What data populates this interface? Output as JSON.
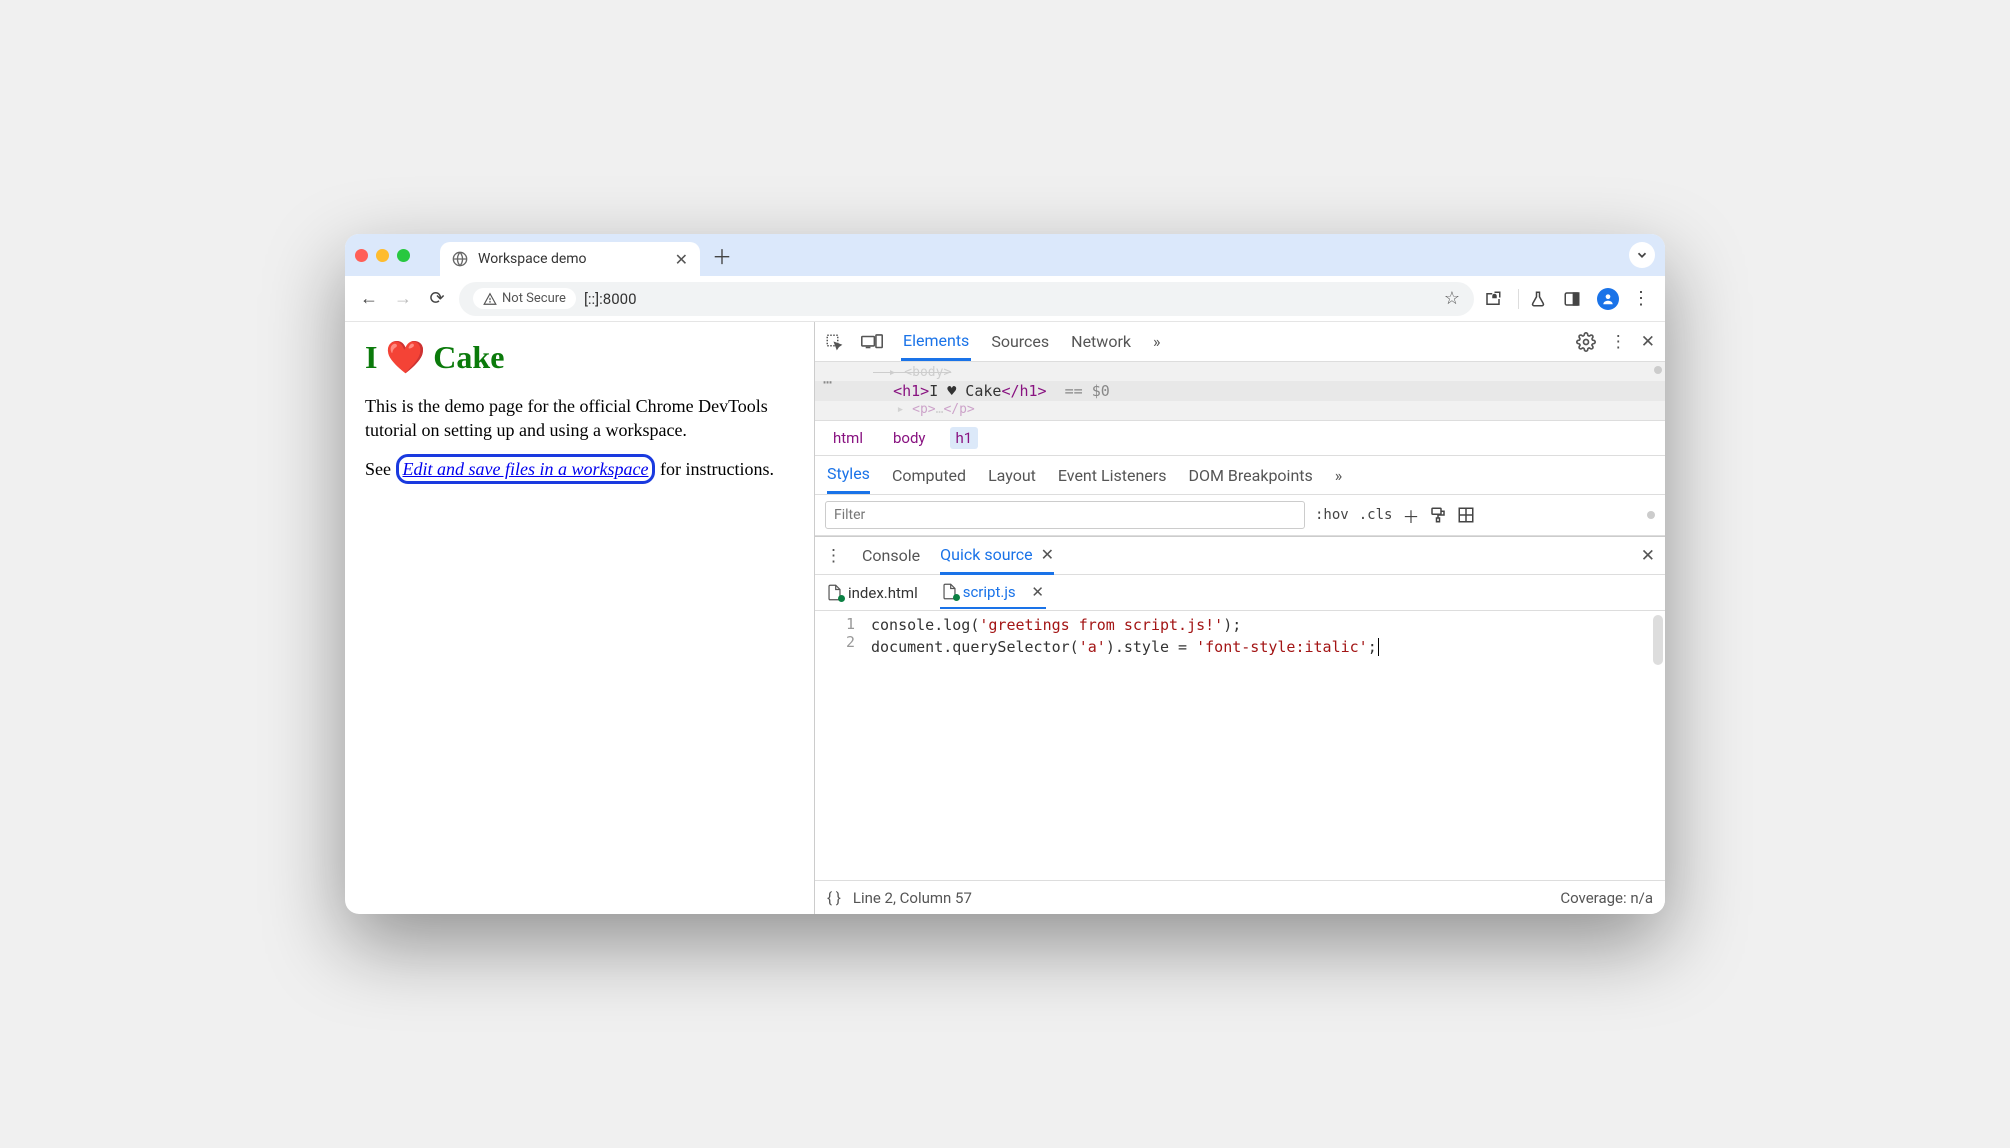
{
  "window": {
    "tab_title": "Workspace demo",
    "security_label": "Not Secure",
    "url": "[::]:8000"
  },
  "page": {
    "heading_prefix": "I ",
    "heading_emoji": "❤️",
    "heading_suffix": " Cake",
    "para1": "This is the demo page for the official Chrome DevTools tutorial on setting up and using a workspace.",
    "para2_prefix": "See ",
    "para2_link": "Edit and save files in a workspace",
    "para2_suffix": " for instructions."
  },
  "devtools": {
    "tabs": {
      "elements": "Elements",
      "sources": "Sources",
      "network": "Network"
    },
    "dom": {
      "line_before": "<body>",
      "h1_open": "<h1>",
      "h1_text": "I ♥ Cake",
      "h1_close": "</h1>",
      "eq": "== $0",
      "line_after": "<p>…</p>"
    },
    "crumbs": {
      "html": "html",
      "body": "body",
      "h1": "h1"
    },
    "styles_tabs": {
      "styles": "Styles",
      "computed": "Computed",
      "layout": "Layout",
      "eventlisteners": "Event Listeners",
      "dombp": "DOM Breakpoints"
    },
    "styles_filter_placeholder": "Filter",
    "hov": ":hov",
    "cls": ".cls",
    "drawer": {
      "console": "Console",
      "quicksource": "Quick source",
      "files": {
        "index": "index.html",
        "script": "script.js"
      },
      "code_line1": "console.log('greetings from script.js!');",
      "code_line2": "document.querySelector('a').style = 'font-style:italic';",
      "line1_num": "1",
      "line2_num": "2",
      "status_pos": "Line 2, Column 57",
      "coverage": "Coverage: n/a"
    }
  }
}
